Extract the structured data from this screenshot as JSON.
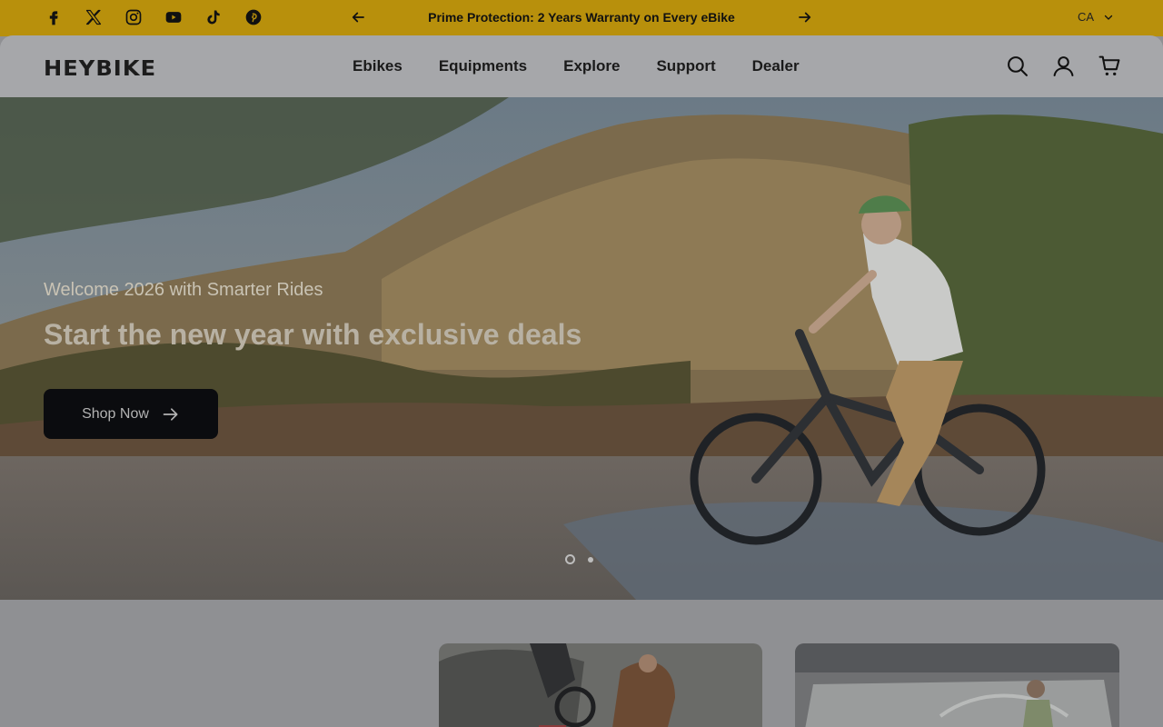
{
  "announcement": {
    "social": [
      {
        "name": "facebook-icon"
      },
      {
        "name": "x-icon"
      },
      {
        "name": "instagram-icon"
      },
      {
        "name": "youtube-icon"
      },
      {
        "name": "tiktok-icon"
      },
      {
        "name": "pinterest-icon"
      }
    ],
    "message": "Prime Protection: 2 Years Warranty on Every eBike",
    "country": "CA",
    "bg_color": "#b8900c"
  },
  "header": {
    "logo": "HEYBIKE",
    "nav": [
      "Ebikes",
      "Equipments",
      "Explore",
      "Support",
      "Dealer"
    ]
  },
  "hero": {
    "subtitle": "Welcome 2026 with Smarter Rides",
    "title": "Start the new year with exclusive deals",
    "cta_label": "Shop Now",
    "slides_total": 2,
    "active_slide": 1
  }
}
